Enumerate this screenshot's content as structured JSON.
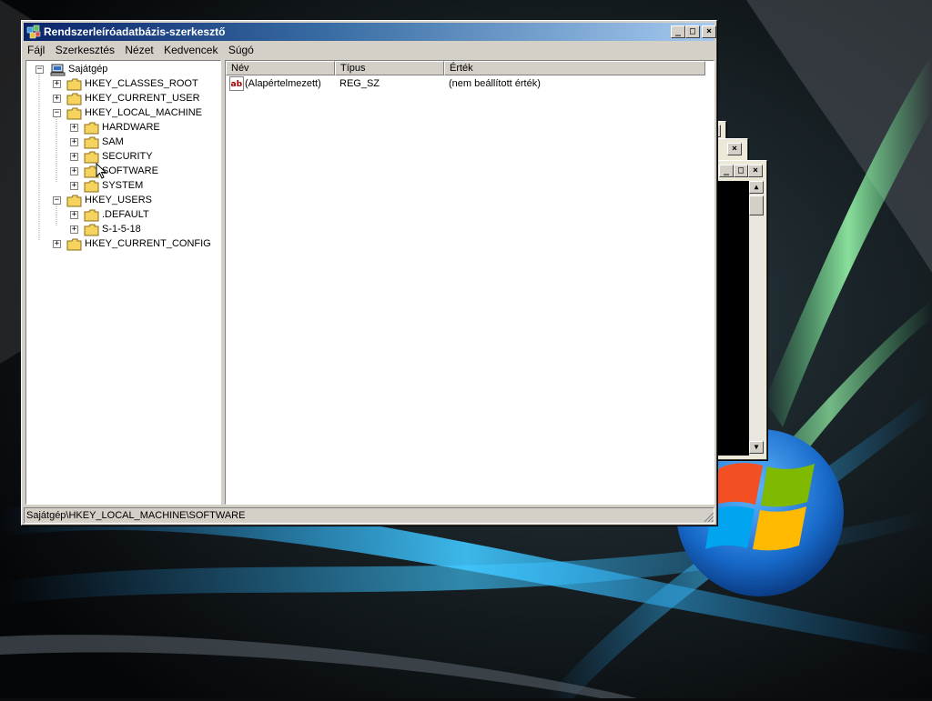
{
  "window": {
    "title": "Rendszerleíróadatbázis-szerkesztő",
    "controls": {
      "minimize": "_",
      "maximize": "□",
      "close": "×"
    }
  },
  "menu": [
    "Fájl",
    "Szerkesztés",
    "Nézet",
    "Kedvencek",
    "Súgó"
  ],
  "tree": {
    "root": "Sajátgép",
    "hkcr": "HKEY_CLASSES_ROOT",
    "hkcu": "HKEY_CURRENT_USER",
    "hklm": "HKEY_LOCAL_MACHINE",
    "hardware": "HARDWARE",
    "sam": "SAM",
    "security": "SECURITY",
    "software": "SOFTWARE",
    "system": "SYSTEM",
    "hku": "HKEY_USERS",
    "default": ".DEFAULT",
    "s1518": "S-1-5-18",
    "hkcc": "HKEY_CURRENT_CONFIG",
    "expanded_sign": "−",
    "collapsed_sign": "+"
  },
  "list": {
    "columns": [
      "Név",
      "Típus",
      "Érték"
    ],
    "rows": [
      {
        "name": "(Alapértelmezett)",
        "type": "REG_SZ",
        "value": "(nem beállított érték)"
      }
    ]
  },
  "status": "Sajátgép\\HKEY_LOCAL_MACHINE\\SOFTWARE",
  "colors": {
    "titlebar_start": "#0a246a",
    "titlebar_end": "#a6caf0",
    "face": "#d4d0c8"
  }
}
